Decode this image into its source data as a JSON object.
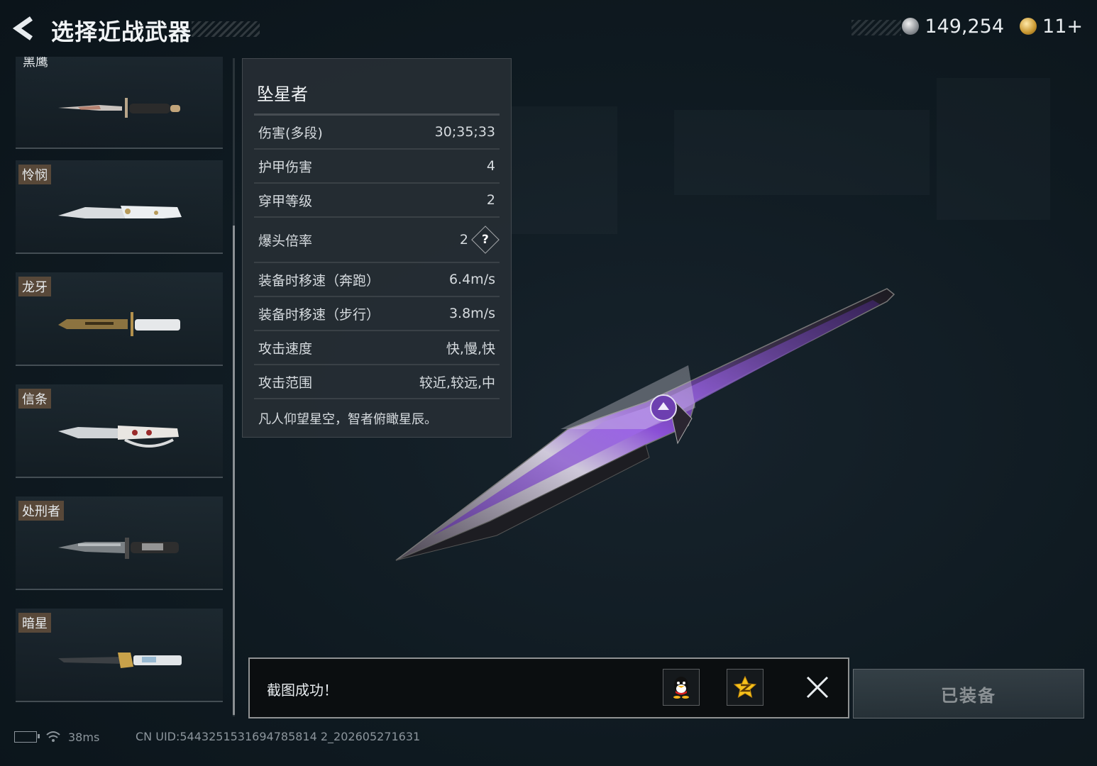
{
  "header": {
    "title": "选择近战武器",
    "currency_silver": "149,254",
    "currency_gold": "11+"
  },
  "weapon_list": {
    "items": [
      {
        "name": "黑鹰",
        "icon": "black-eagle-knife"
      },
      {
        "name": "怜悯",
        "icon": "mercy-knife"
      },
      {
        "name": "龙牙",
        "icon": "dragon-fang-knife"
      },
      {
        "name": "信条",
        "icon": "creed-knuckle-knife"
      },
      {
        "name": "处刑者",
        "icon": "executioner-knife"
      },
      {
        "name": "暗星",
        "icon": "dark-star-knife"
      }
    ]
  },
  "stats": {
    "weapon_name": "坠星者",
    "rows": [
      {
        "label": "伤害(多段)",
        "value": "30;35;33"
      },
      {
        "label": "护甲伤害",
        "value": "4"
      },
      {
        "label": "穿甲等级",
        "value": "2"
      },
      {
        "label": "爆头倍率",
        "value": "2",
        "help": "?"
      },
      {
        "label": "装备时移速（奔跑）",
        "value": "6.4m/s"
      },
      {
        "label": "装备时移速（步行）",
        "value": "3.8m/s"
      },
      {
        "label": "攻击速度",
        "value": "快,慢,快"
      },
      {
        "label": "攻击范围",
        "value": "较近,较远,中"
      }
    ],
    "description": "凡人仰望星空，智者俯瞰星辰。"
  },
  "toast": {
    "message": "截图成功！",
    "share_targets": [
      "qq-icon",
      "qzone-icon"
    ],
    "close_icon": "close-icon"
  },
  "equip": {
    "label": "已装备"
  },
  "status_bar": {
    "ping": "38ms",
    "uid": "CN UID:5443251531694785814 2_202605271631"
  },
  "colors": {
    "accent_purple": "#8a4fd6",
    "tag_brown": "#6e543e"
  }
}
